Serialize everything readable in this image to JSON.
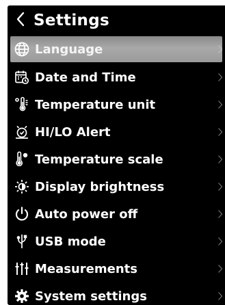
{
  "header": {
    "title": "Settings",
    "back_icon": "chevron-left-icon"
  },
  "menu": {
    "items": [
      {
        "label": "Language",
        "icon": "globe-icon",
        "selected": true
      },
      {
        "label": "Date and Time",
        "icon": "calendar-icon",
        "selected": false
      },
      {
        "label": "Temperature unit",
        "icon": "thermometer-unit-icon",
        "selected": false
      },
      {
        "label": "HI/LO Alert",
        "icon": "alarm-icon",
        "selected": false
      },
      {
        "label": "Temperature scale",
        "icon": "thermometer-scale-icon",
        "selected": false
      },
      {
        "label": "Display brightness",
        "icon": "brightness-icon",
        "selected": false
      },
      {
        "label": "Auto power off",
        "icon": "power-icon",
        "selected": false
      },
      {
        "label": "USB mode",
        "icon": "usb-icon",
        "selected": false
      },
      {
        "label": "Measurements",
        "icon": "sliders-icon",
        "selected": false
      },
      {
        "label": "System settings",
        "icon": "gear-icon",
        "selected": false
      }
    ]
  },
  "colors": {
    "background": "#000000",
    "text": "#ffffff",
    "selected_highlight": "#a9a9a9",
    "chevron": "#6a6a6a"
  }
}
